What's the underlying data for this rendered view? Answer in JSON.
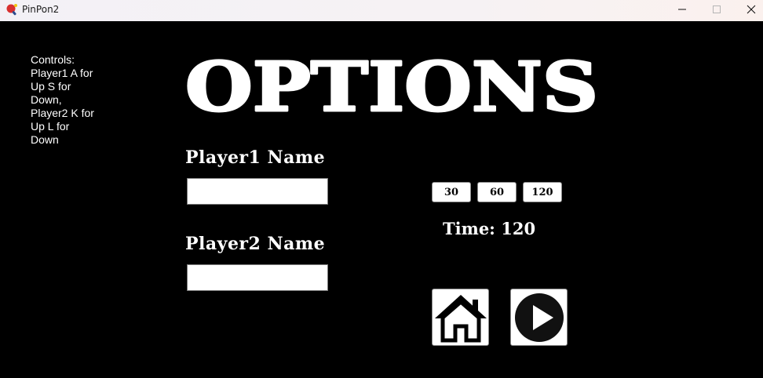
{
  "window": {
    "title": "PinPon2"
  },
  "controls": {
    "lines": [
      "Controls:",
      "Player1 A for",
      "Up S for",
      "Down,",
      "Player2 K for",
      "Up L for",
      "Down"
    ]
  },
  "page": {
    "title": "OPTIONS"
  },
  "player1": {
    "label": "Player1 Name",
    "value": "",
    "placeholder": ""
  },
  "player2": {
    "label": "Player2 Name",
    "value": "",
    "placeholder": ""
  },
  "time": {
    "options": [
      "30",
      "60",
      "120"
    ],
    "label": "Time:",
    "value": "120"
  },
  "icons": {
    "app": "ping-pong-paddle-icon",
    "home": "home-icon",
    "play": "play-icon"
  },
  "colors": {
    "background": "#000000",
    "foreground": "#ffffff"
  }
}
